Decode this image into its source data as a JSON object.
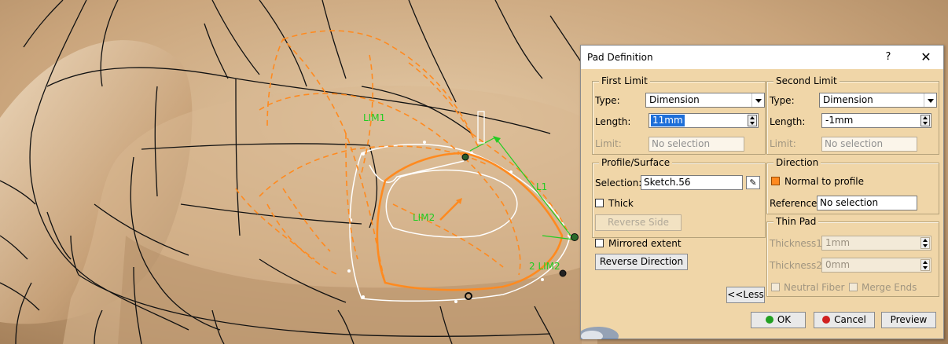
{
  "viewport": {
    "labels": {
      "lim1": "LIM1",
      "lim2": "LIM2",
      "l1": "L1",
      "l2": "2 LIM2"
    }
  },
  "dialog": {
    "title": "Pad Definition",
    "help": "?",
    "close": "✕",
    "first_limit": {
      "title": "First Limit",
      "type_label": "Type:",
      "type_value": "Dimension",
      "length_label": "Length:",
      "length_value": "11mm",
      "limit_label": "Limit:",
      "limit_value": "No selection"
    },
    "second_limit": {
      "title": "Second Limit",
      "type_label": "Type:",
      "type_value": "Dimension",
      "length_label": "Length:",
      "length_value": "-1mm",
      "limit_label": "Limit:",
      "limit_value": "No selection"
    },
    "profile": {
      "title": "Profile/Surface",
      "selection_label": "Selection:",
      "selection_value": "Sketch.56",
      "thick_label": "Thick",
      "reverse_side": "Reverse Side"
    },
    "direction": {
      "title": "Direction",
      "normal_label": "Normal to profile",
      "reference_label": "Reference:",
      "reference_value": "No selection"
    },
    "thin_pad": {
      "title": "Thin Pad",
      "thickness1_label": "Thickness1:",
      "thickness1_value": "1mm",
      "thickness2_label": "Thickness2:",
      "thickness2_value": "0mm",
      "neutral_label": "Neutral Fiber",
      "merge_label": "Merge Ends"
    },
    "mirrored_label": "Mirrored extent",
    "reverse_direction": "Reverse Direction",
    "less_button": "<<Less",
    "ok": "OK",
    "cancel": "Cancel",
    "preview": "Preview"
  },
  "colors": {
    "dialog_bg": "#f0d6a8",
    "preview_orange": "#ff8a1f",
    "ok_icon": "#22a022",
    "cancel_icon": "#d02020",
    "label_green": "#22cc22"
  }
}
